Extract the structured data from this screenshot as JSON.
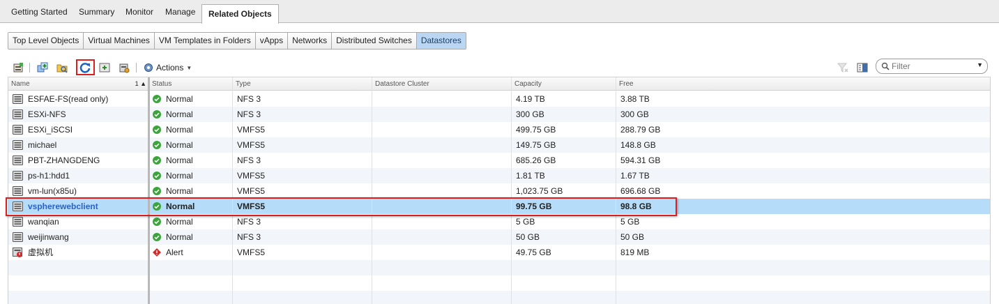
{
  "top_tabs": [
    {
      "label": "Getting Started"
    },
    {
      "label": "Summary"
    },
    {
      "label": "Monitor"
    },
    {
      "label": "Manage"
    },
    {
      "label": "Related Objects"
    }
  ],
  "sub_tabs": [
    {
      "label": "Top Level Objects"
    },
    {
      "label": "Virtual Machines"
    },
    {
      "label": "VM Templates in Folders"
    },
    {
      "label": "vApps"
    },
    {
      "label": "Networks"
    },
    {
      "label": "Distributed Switches"
    },
    {
      "label": "Datastores"
    }
  ],
  "toolbar": {
    "actions_label": "Actions",
    "filter_placeholder": "Filter"
  },
  "columns": {
    "name": "Name",
    "name_sort": "1 ▲",
    "status": "Status",
    "type": "Type",
    "cluster": "Datastore Cluster",
    "capacity": "Capacity",
    "free": "Free"
  },
  "rows": [
    {
      "name": "ESFAE-FS(read only)",
      "status": "Normal",
      "type": "NFS 3",
      "cluster": "",
      "capacity": "4.19  TB",
      "free": "3.88  TB"
    },
    {
      "name": "ESXi-NFS",
      "status": "Normal",
      "type": "NFS 3",
      "cluster": "",
      "capacity": "300  GB",
      "free": "300  GB"
    },
    {
      "name": "ESXi_iSCSI",
      "status": "Normal",
      "type": "VMFS5",
      "cluster": "",
      "capacity": "499.75  GB",
      "free": "288.79  GB"
    },
    {
      "name": "michael",
      "status": "Normal",
      "type": "VMFS5",
      "cluster": "",
      "capacity": "149.75  GB",
      "free": "148.8  GB"
    },
    {
      "name": "PBT-ZHANGDENG",
      "status": "Normal",
      "type": "NFS 3",
      "cluster": "",
      "capacity": "685.26  GB",
      "free": "594.31  GB"
    },
    {
      "name": "ps-h1:hdd1",
      "status": "Normal",
      "type": "VMFS5",
      "cluster": "",
      "capacity": "1.81  TB",
      "free": "1.67  TB"
    },
    {
      "name": "vm-lun(x85u)",
      "status": "Normal",
      "type": "VMFS5",
      "cluster": "",
      "capacity": "1,023.75  GB",
      "free": "696.68  GB"
    },
    {
      "name": "vspherewebclient",
      "status": "Normal",
      "type": "VMFS5",
      "cluster": "",
      "capacity": "99.75  GB",
      "free": "98.8  GB"
    },
    {
      "name": "wanqian",
      "status": "Normal",
      "type": "NFS 3",
      "cluster": "",
      "capacity": "5  GB",
      "free": "5  GB"
    },
    {
      "name": "weijinwang",
      "status": "Normal",
      "type": "NFS 3",
      "cluster": "",
      "capacity": "50  GB",
      "free": "50  GB"
    },
    {
      "name": "虚拟机",
      "status": "Alert",
      "type": "VMFS5",
      "cluster": "",
      "capacity": "49.75  GB",
      "free": "819  MB"
    }
  ],
  "colors": {
    "selected_row": "#b5dcf8",
    "highlight": "#d91f1f",
    "normal_status": "#3aa63a",
    "alert_status": "#d42c2c"
  }
}
